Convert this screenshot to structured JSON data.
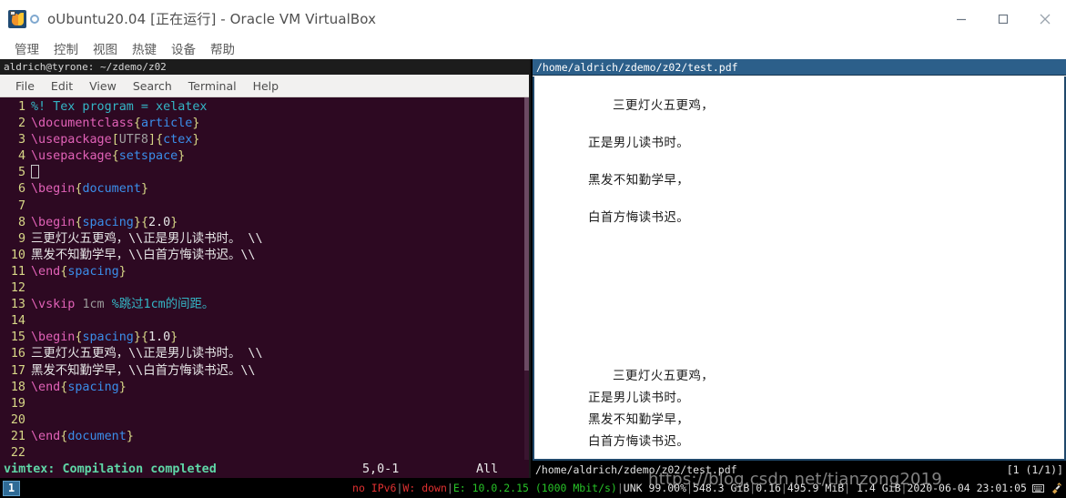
{
  "host_window": {
    "title": "oUbuntu20.04 [正在运行] - Oracle VM VirtualBox",
    "app_icon": "virtualbox-icon",
    "controls": {
      "minimize": "minimize-icon",
      "maximize": "maximize-icon",
      "close": "close-icon"
    },
    "menu": [
      {
        "label": "管理"
      },
      {
        "label": "控制"
      },
      {
        "label": "视图"
      },
      {
        "label": "热键"
      },
      {
        "label": "设备"
      },
      {
        "label": "帮助"
      }
    ]
  },
  "terminal": {
    "title": "aldrich@tyrone: ~/zdemo/z02",
    "menu": [
      {
        "label": "File"
      },
      {
        "label": "Edit"
      },
      {
        "label": "View"
      },
      {
        "label": "Search"
      },
      {
        "label": "Terminal"
      },
      {
        "label": "Help"
      }
    ],
    "lines": [
      {
        "n": "1",
        "tokens": [
          {
            "t": "%! Tex program = xelatex",
            "c": "c-comment"
          }
        ]
      },
      {
        "n": "2",
        "tokens": [
          {
            "t": "\\documentclass",
            "c": "c-cmd"
          },
          {
            "t": "{",
            "c": "c-brace"
          },
          {
            "t": "article",
            "c": "c-arg"
          },
          {
            "t": "}",
            "c": "c-brace"
          }
        ]
      },
      {
        "n": "3",
        "tokens": [
          {
            "t": "\\usepackage",
            "c": "c-cmd"
          },
          {
            "t": "[",
            "c": "c-brace"
          },
          {
            "t": "UTF8",
            "c": "c-opt"
          },
          {
            "t": "]",
            "c": "c-brace"
          },
          {
            "t": "{",
            "c": "c-brace"
          },
          {
            "t": "ctex",
            "c": "c-arg"
          },
          {
            "t": "}",
            "c": "c-brace"
          }
        ]
      },
      {
        "n": "4",
        "tokens": [
          {
            "t": "\\usepackage",
            "c": "c-cmd"
          },
          {
            "t": "{",
            "c": "c-brace"
          },
          {
            "t": "setspace",
            "c": "c-arg"
          },
          {
            "t": "}",
            "c": "c-brace"
          }
        ]
      },
      {
        "n": "5",
        "tokens": [
          {
            "t": "",
            "c": "c-text",
            "cursor": true
          }
        ]
      },
      {
        "n": "6",
        "tokens": [
          {
            "t": "\\begin",
            "c": "c-cmd"
          },
          {
            "t": "{",
            "c": "c-brace"
          },
          {
            "t": "document",
            "c": "c-arg"
          },
          {
            "t": "}",
            "c": "c-brace"
          }
        ]
      },
      {
        "n": "7",
        "tokens": [
          {
            "t": "",
            "c": "c-text"
          }
        ]
      },
      {
        "n": "8",
        "tokens": [
          {
            "t": "\\begin",
            "c": "c-cmd"
          },
          {
            "t": "{",
            "c": "c-brace"
          },
          {
            "t": "spacing",
            "c": "c-arg"
          },
          {
            "t": "}",
            "c": "c-brace"
          },
          {
            "t": "{",
            "c": "c-brace"
          },
          {
            "t": "2.0",
            "c": "c-text"
          },
          {
            "t": "}",
            "c": "c-brace"
          }
        ]
      },
      {
        "n": "9",
        "tokens": [
          {
            "t": "三更灯火五更鸡，\\\\正是男儿读书时。 \\\\",
            "c": "c-text"
          }
        ]
      },
      {
        "n": "10",
        "tokens": [
          {
            "t": "黑发不知勤学早，\\\\白首方悔读书迟。\\\\",
            "c": "c-text"
          }
        ]
      },
      {
        "n": "11",
        "tokens": [
          {
            "t": "\\end",
            "c": "c-cmd"
          },
          {
            "t": "{",
            "c": "c-brace"
          },
          {
            "t": "spacing",
            "c": "c-arg"
          },
          {
            "t": "}",
            "c": "c-brace"
          }
        ]
      },
      {
        "n": "12",
        "tokens": [
          {
            "t": "",
            "c": "c-text"
          }
        ]
      },
      {
        "n": "13",
        "tokens": [
          {
            "t": "\\vskip",
            "c": "c-cmd"
          },
          {
            "t": " ",
            "c": "c-text"
          },
          {
            "t": "1cm",
            "c": "c-dim"
          },
          {
            "t": " ",
            "c": "c-text"
          },
          {
            "t": "%跳过1cm的间距。",
            "c": "c-comment"
          }
        ]
      },
      {
        "n": "14",
        "tokens": [
          {
            "t": "",
            "c": "c-text"
          }
        ]
      },
      {
        "n": "15",
        "tokens": [
          {
            "t": "\\begin",
            "c": "c-cmd"
          },
          {
            "t": "{",
            "c": "c-brace"
          },
          {
            "t": "spacing",
            "c": "c-arg"
          },
          {
            "t": "}",
            "c": "c-brace"
          },
          {
            "t": "{",
            "c": "c-brace"
          },
          {
            "t": "1.0",
            "c": "c-text"
          },
          {
            "t": "}",
            "c": "c-brace"
          }
        ]
      },
      {
        "n": "16",
        "tokens": [
          {
            "t": "三更灯火五更鸡，\\\\正是男儿读书时。 \\\\",
            "c": "c-text"
          }
        ]
      },
      {
        "n": "17",
        "tokens": [
          {
            "t": "黑发不知勤学早，\\\\白首方悔读书迟。\\\\",
            "c": "c-text"
          }
        ]
      },
      {
        "n": "18",
        "tokens": [
          {
            "t": "\\end",
            "c": "c-cmd"
          },
          {
            "t": "{",
            "c": "c-brace"
          },
          {
            "t": "spacing",
            "c": "c-arg"
          },
          {
            "t": "}",
            "c": "c-brace"
          }
        ]
      },
      {
        "n": "19",
        "tokens": [
          {
            "t": "",
            "c": "c-text"
          }
        ]
      },
      {
        "n": "20",
        "tokens": [
          {
            "t": "",
            "c": "c-text"
          }
        ]
      },
      {
        "n": "21",
        "tokens": [
          {
            "t": "\\end",
            "c": "c-cmd"
          },
          {
            "t": "{",
            "c": "c-brace"
          },
          {
            "t": "document",
            "c": "c-arg"
          },
          {
            "t": "}",
            "c": "c-brace"
          }
        ]
      },
      {
        "n": "22",
        "tokens": [
          {
            "t": "",
            "c": "c-text"
          }
        ]
      }
    ],
    "status": {
      "message": "vimtex: Compilation completed",
      "position": "5,0-1",
      "scroll": "All"
    }
  },
  "pdf_viewer": {
    "title": "/home/aldrich/zdemo/z02/test.pdf",
    "status_path": "/home/aldrich/zdemo/z02/test.pdf",
    "status_page": "[1 (1/1)]",
    "blocks": [
      {
        "spacing": "2.0",
        "lines": [
          {
            "text": "三更灯火五更鸡，",
            "indent": true
          },
          {
            "text": "正是男儿读书时。",
            "indent": false
          },
          {
            "text": "黑发不知勤学早，",
            "indent": false
          },
          {
            "text": "白首方悔读书迟。",
            "indent": false
          }
        ]
      },
      {
        "spacing": "1.0",
        "lines": [
          {
            "text": "三更灯火五更鸡，",
            "indent": true
          },
          {
            "text": "正是男儿读书时。",
            "indent": false
          },
          {
            "text": "黑发不知勤学早，",
            "indent": false
          },
          {
            "text": "白首方悔读书迟。",
            "indent": false
          }
        ]
      }
    ]
  },
  "taskbar": {
    "workspace": "1",
    "segments": [
      {
        "text": "no IPv6",
        "c": "tb-red"
      },
      {
        "text": "|",
        "c": "tb-sep"
      },
      {
        "text": "W: down",
        "c": "tb-red"
      },
      {
        "text": "|",
        "c": "tb-sep"
      },
      {
        "text": "E: 10.0.2.15 (1000 Mbit/s)",
        "c": "tb-green"
      },
      {
        "text": "|",
        "c": "tb-sep"
      },
      {
        "text": "UNK 99.00%",
        "c": "tb-white"
      },
      {
        "text": "|",
        "c": "tb-sep"
      },
      {
        "text": "548.3 GiB",
        "c": "tb-white"
      },
      {
        "text": "|",
        "c": "tb-sep"
      },
      {
        "text": "0.16",
        "c": "tb-white"
      },
      {
        "text": "|",
        "c": "tb-sep"
      },
      {
        "text": "495.9 MiB",
        "c": "tb-white"
      },
      {
        "text": "|",
        "c": "tb-sep"
      },
      {
        "text": " 1.4 GiB",
        "c": "tb-white"
      },
      {
        "text": "|",
        "c": "tb-sep"
      },
      {
        "text": "2020-06-04 23:01:05",
        "c": "tb-white"
      }
    ],
    "tray": [
      {
        "icon": "keyboard-icon"
      },
      {
        "icon": "plug-icon"
      }
    ]
  },
  "watermark": {
    "text": "https://blog.csdn.net/tianzong2019"
  },
  "colors": {
    "terminal_bg": "#2d0922",
    "zathura_accent": "#2c5f8a",
    "workspace_accent": "#2f6b96",
    "comment": "#34b6c6",
    "command": "#e262b8",
    "brace": "#d7d787",
    "argument": "#3b8eea"
  }
}
